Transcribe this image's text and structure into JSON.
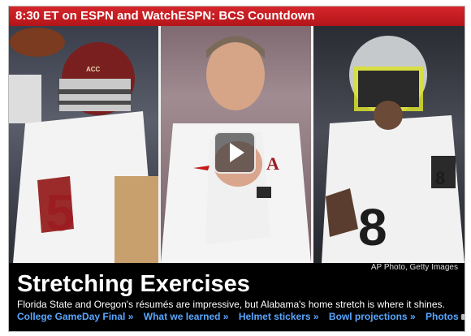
{
  "banner": {
    "text": "8:30 ET on ESPN and WatchESPN: BCS Countdown"
  },
  "credit": "AP Photo, Getty Images",
  "headline": "Stretching Exercises",
  "dek": "Florida State and Oregon's résumés are impressive, but Alabama's home stretch is where it shines.",
  "links": [
    {
      "label": "College GameDay Final",
      "arrow": "»"
    },
    {
      "label": "What we learned",
      "arrow": "»"
    },
    {
      "label": "Helmet stickers",
      "arrow": "»"
    },
    {
      "label": "Bowl projections",
      "arrow": "»"
    },
    {
      "label": "Photos"
    }
  ],
  "colors": {
    "banner": "#c41e23",
    "link": "#59a7ff"
  },
  "jersey": {
    "left": "5",
    "right": "8",
    "badge": "ACC",
    "logo": "A"
  }
}
